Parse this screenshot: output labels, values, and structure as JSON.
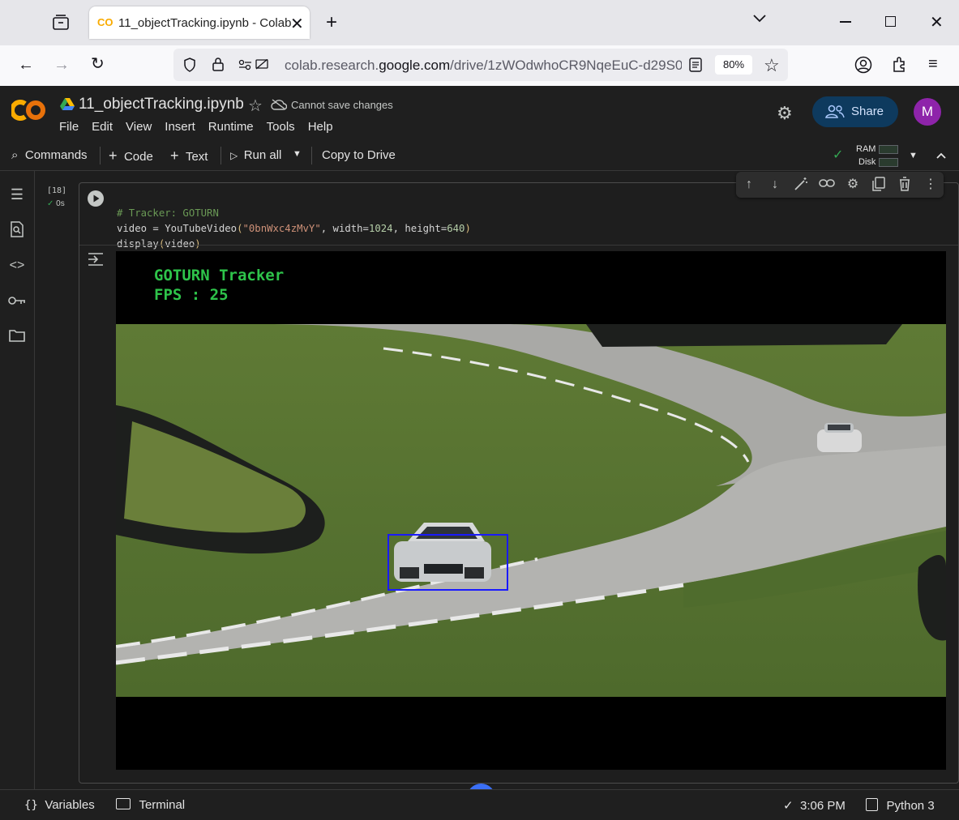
{
  "browser": {
    "tab_title": "11_objectTracking.ipynb - Colab",
    "new_tab": "+",
    "url_prefix": "colab.research.",
    "url_domain": "google.com",
    "url_path": "/drive/1zWOdwhoCR9NqeEuC-d29S0",
    "zoom": "80%"
  },
  "colab": {
    "logo": "CO",
    "notebook_name": "11_objectTracking.ipynb",
    "save_status": "Cannot save changes",
    "share_label": "Share",
    "avatar_initial": "M",
    "menu": [
      "File",
      "Edit",
      "View",
      "Insert",
      "Runtime",
      "Tools",
      "Help"
    ],
    "toolbar": {
      "commands": "Commands",
      "code": "Code",
      "text": "Text",
      "run_all": "Run all",
      "copy_to_drive": "Copy to Drive",
      "ram": "RAM",
      "disk": "Disk"
    }
  },
  "cell": {
    "exec_count": "[18]",
    "exec_time": "0s",
    "line1_comment": "# Tracker: GOTURN",
    "line2_a": "video = YouTubeVideo",
    "line2_str": "\"0bnWxc4zMvY\"",
    "line2_b": ", width=",
    "line2_n1": "1024",
    "line2_c": ", height=",
    "line2_n2": "640",
    "line3_a": "display",
    "line3_b": "video"
  },
  "video": {
    "hud_title": "GOTURN Tracker",
    "hud_fps": "FPS : 25"
  },
  "statusbar": {
    "variables": "Variables",
    "terminal": "Terminal",
    "time": "3:06 PM",
    "runtime": "Python 3"
  },
  "colors": {
    "accent_blue": "#0b57d0",
    "share_bg": "#0e3a5e",
    "tracker_box": "#1a1aff",
    "hud_green": "#2ec34a",
    "colab_orange": "#f9ab00"
  }
}
